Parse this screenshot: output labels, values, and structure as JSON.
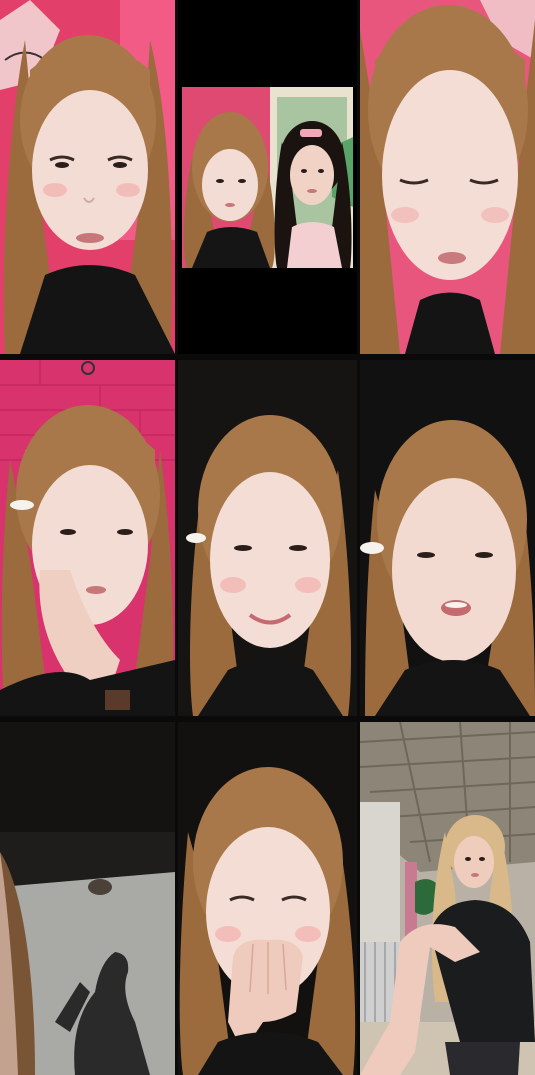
{
  "grid": {
    "rows": 3,
    "columns": 3,
    "tiles": [
      {
        "scene": "pink-wall-portrait",
        "background": "#e0426a"
      },
      {
        "scene": "black-frame-with-two-person-inset",
        "background": "#000000"
      },
      {
        "scene": "pink-wall-closeup",
        "background": "#e8567e"
      },
      {
        "scene": "pink-brick-hand-on-cheek",
        "background": "#d8336c"
      },
      {
        "scene": "dark-portrait-smiling",
        "background": "#151413"
      },
      {
        "scene": "dark-portrait-talking",
        "background": "#121111"
      },
      {
        "scene": "night-shadow-on-pavement",
        "background": "#1a1918"
      },
      {
        "scene": "dark-portrait-hand-over-mouth",
        "background": "#121110"
      },
      {
        "scene": "outdoor-porch-dancing",
        "background": "#b9b1a6"
      }
    ]
  },
  "colors": {
    "skin": "#f2d6cc",
    "hair": "#9a6b3e",
    "shirt": "#121212",
    "pink_wall": "#e0426a"
  }
}
